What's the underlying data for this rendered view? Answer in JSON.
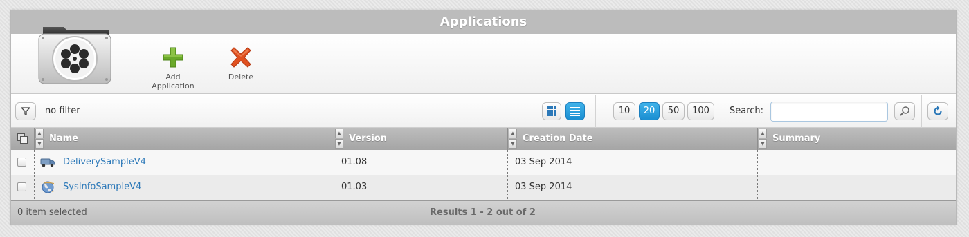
{
  "window": {
    "title": "Applications"
  },
  "toolbar": {
    "add_label": "Add Application",
    "delete_label": "Delete"
  },
  "filter": {
    "label": "no filter"
  },
  "page_sizes": [
    "10",
    "20",
    "50",
    "100"
  ],
  "page_size_selected": "20",
  "search": {
    "label": "Search:",
    "value": "",
    "placeholder": ""
  },
  "table": {
    "columns": [
      "Name",
      "Version",
      "Creation Date",
      "Summary"
    ],
    "rows": [
      {
        "name": "DeliverySampleV4",
        "icon": "delivery-truck-icon",
        "version": "01.08",
        "created": "03 Sep 2014",
        "summary": ""
      },
      {
        "name": "SysInfoSampleV4",
        "icon": "globe-icon",
        "version": "01.03",
        "created": "03 Sep 2014",
        "summary": ""
      }
    ]
  },
  "footer": {
    "selection": "0 item selected",
    "results": "Results 1 - 2 out of 2"
  },
  "colors": {
    "accent": "#1b8fd2",
    "link": "#2b78b8",
    "add": "#6aa92a",
    "delete": "#e0501f"
  }
}
